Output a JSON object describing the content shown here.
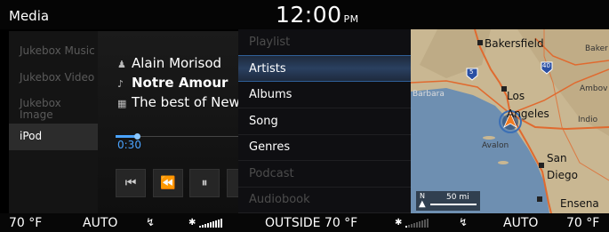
{
  "header": {
    "title": "Media",
    "time": "12:00",
    "ampm": "PM"
  },
  "sources": [
    {
      "label": "Jukebox Music",
      "active": false
    },
    {
      "label": "Jukebox Video",
      "active": false
    },
    {
      "label": "Jukebox Image",
      "active": false
    },
    {
      "label": "iPod",
      "active": true
    }
  ],
  "now_playing": {
    "artist": "Alain Morisod",
    "title": "Notre Amour",
    "album": "The best of Newa",
    "elapsed": "0:30",
    "icons": {
      "artist": "person-icon",
      "title": "music-note-icon",
      "album": "album-icon"
    },
    "controls": [
      {
        "name": "skip-previous-icon",
        "glyph": "⏮"
      },
      {
        "name": "rewind-icon",
        "glyph": "⏪"
      },
      {
        "name": "pause-icon",
        "glyph": "⏸"
      }
    ]
  },
  "menu": [
    {
      "label": "Playlist",
      "state": "dim"
    },
    {
      "label": "Artists",
      "state": "selected"
    },
    {
      "label": "Albums",
      "state": "on"
    },
    {
      "label": "Song",
      "state": "on"
    },
    {
      "label": "Genres",
      "state": "on"
    },
    {
      "label": "Podcast",
      "state": "dim"
    },
    {
      "label": "Audiobook",
      "state": "dim"
    }
  ],
  "map": {
    "labels": [
      "Bakersfield",
      "Baker",
      "Los",
      "Angeles",
      "San",
      "Diego",
      "Ensena",
      "Ambov",
      "Indio",
      "Avalon",
      "Barbara"
    ],
    "highway_5": "5",
    "highway_40": "40",
    "scale_n": "N",
    "scale": "50 mi",
    "colors": {
      "land": "#c9b792",
      "sea": "#6e8fb1",
      "road": "#e06a2f"
    }
  },
  "climate": {
    "left_temp": "70 °F",
    "left_mode": "AUTO",
    "outside": "OUTSIDE  70 °F",
    "right_mode": "AUTO",
    "right_temp": "70 °F"
  }
}
